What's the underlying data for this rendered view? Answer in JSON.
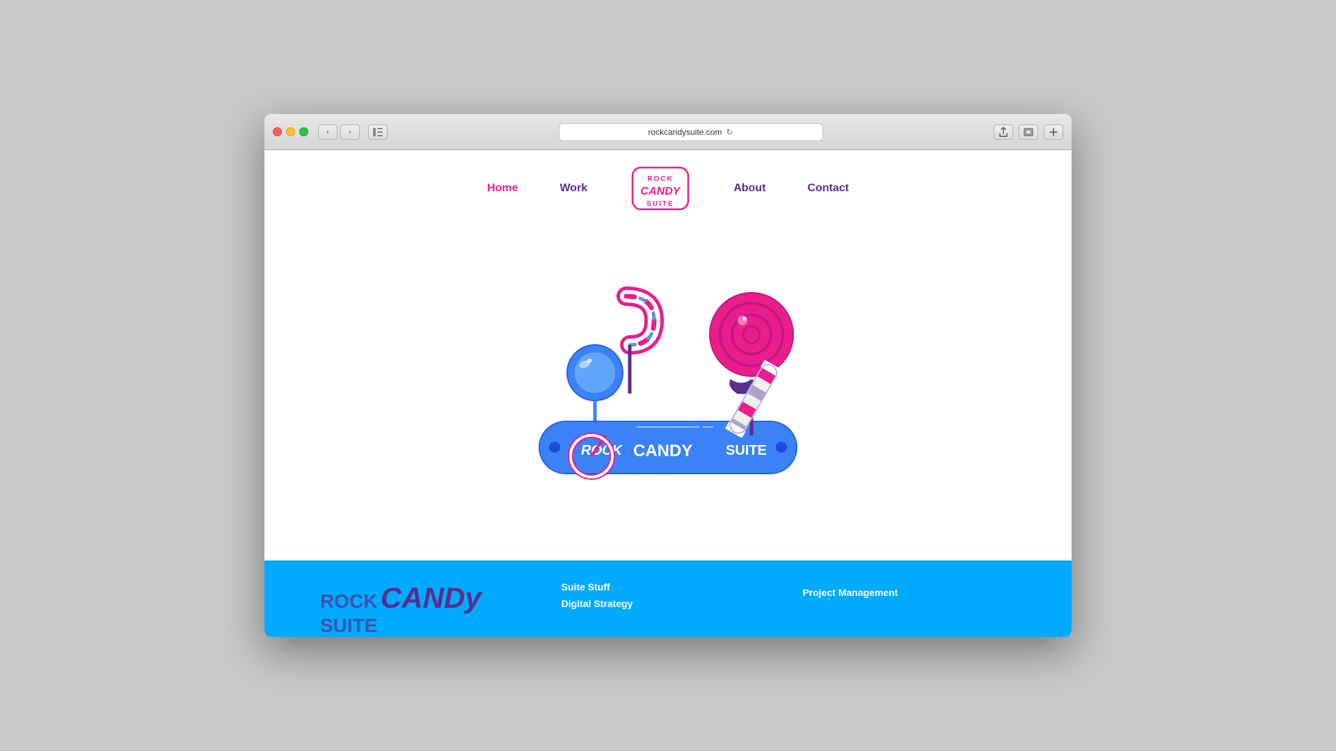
{
  "browser": {
    "url": "rockcandysuite.com",
    "back_label": "‹",
    "forward_label": "›",
    "reload_label": "↻",
    "share_label": "↑",
    "tab_label": "⊡",
    "add_label": "+"
  },
  "nav": {
    "home": "Home",
    "work": "Work",
    "about": "About",
    "contact": "Contact"
  },
  "logo": {
    "rock": "ROCK",
    "candy": "CANDY",
    "suite": "SUITE"
  },
  "footer": {
    "logo_rock": "ROCK",
    "logo_candy": "CANDy",
    "logo_suite": "SUITE",
    "col1_title": "Suite Stuff",
    "col1_item1": "Digital Strategy",
    "col2_title": "",
    "col2_item1": "Project Management"
  }
}
